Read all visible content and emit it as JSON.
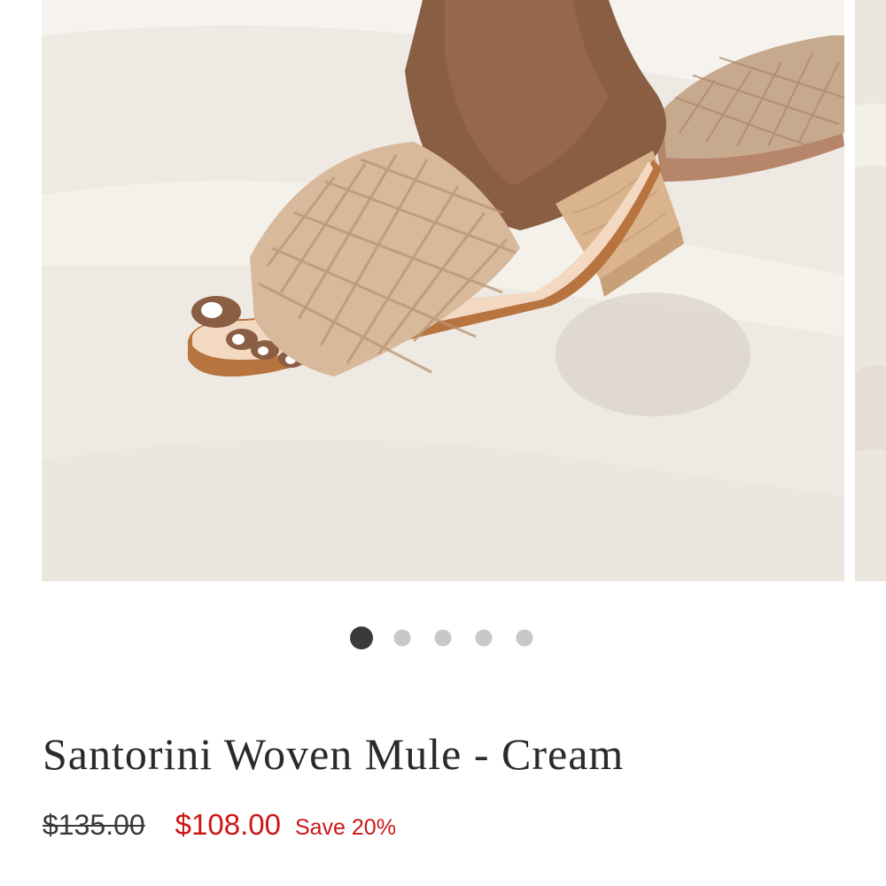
{
  "gallery": {
    "slide_count": 5,
    "active_index": 0,
    "image_description": "Woven leather slide sandal with block wooden heel",
    "colors": {
      "dot_active": "#3a3a3a",
      "dot_inactive": "#c8c8c8"
    }
  },
  "product": {
    "title": "Santorini Woven Mule - Cream",
    "price_original": "$135.00",
    "price_sale": "$108.00",
    "save_label": "Save 20%",
    "colors": {
      "sale": "#cc1616",
      "text": "#2a2a2a"
    }
  }
}
